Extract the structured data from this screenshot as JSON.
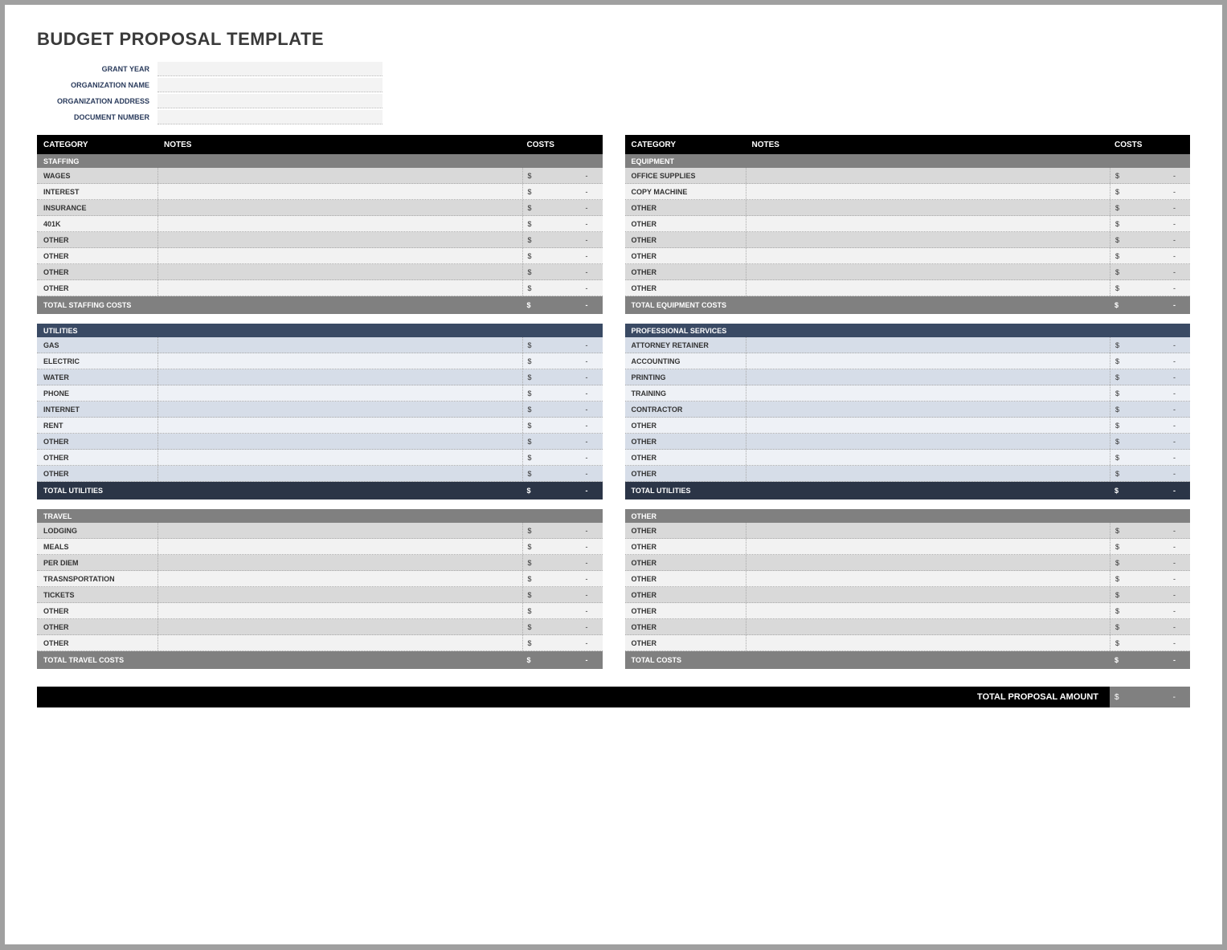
{
  "title": "BUDGET PROPOSAL TEMPLATE",
  "meta": {
    "grant_year_label": "GRANT YEAR",
    "org_name_label": "ORGANIZATION NAME",
    "org_address_label": "ORGANIZATION ADDRESS",
    "doc_number_label": "DOCUMENT NUMBER",
    "grant_year": "",
    "org_name": "",
    "org_address": "",
    "doc_number": ""
  },
  "headers": {
    "category": "CATEGORY",
    "notes": "NOTES",
    "costs": "COSTS"
  },
  "currency": "$",
  "dash": "-",
  "left": {
    "staffing": {
      "title": "STAFFING",
      "rows": [
        "WAGES",
        "INTEREST",
        "INSURANCE",
        "401K",
        "OTHER",
        "OTHER",
        "OTHER",
        "OTHER"
      ],
      "total_label": "TOTAL STAFFING COSTS"
    },
    "utilities": {
      "title": "UTILITIES",
      "rows": [
        "GAS",
        "ELECTRIC",
        "WATER",
        "PHONE",
        "INTERNET",
        "RENT",
        "OTHER",
        "OTHER",
        "OTHER"
      ],
      "total_label": "TOTAL UTILITIES"
    },
    "travel": {
      "title": "TRAVEL",
      "rows": [
        "LODGING",
        "MEALS",
        "PER DIEM",
        "TRASNSPORTATION",
        "TICKETS",
        "OTHER",
        "OTHER",
        "OTHER"
      ],
      "total_label": "TOTAL TRAVEL COSTS"
    }
  },
  "right": {
    "equipment": {
      "title": "EQUIPMENT",
      "rows": [
        "OFFICE SUPPLIES",
        "COPY MACHINE",
        "OTHER",
        "OTHER",
        "OTHER",
        "OTHER",
        "OTHER",
        "OTHER"
      ],
      "total_label": "TOTAL EQUIPMENT COSTS"
    },
    "professional": {
      "title": "PROFESSIONAL SERVICES",
      "rows": [
        "ATTORNEY RETAINER",
        "ACCOUNTING",
        "PRINTING",
        "TRAINING",
        "CONTRACTOR",
        "OTHER",
        "OTHER",
        "OTHER",
        "OTHER"
      ],
      "total_label": "TOTAL UTILITIES"
    },
    "other": {
      "title": "OTHER",
      "rows": [
        "OTHER",
        "OTHER",
        "OTHER",
        "OTHER",
        "OTHER",
        "OTHER",
        "OTHER",
        "OTHER"
      ],
      "total_label": "TOTAL COSTS"
    }
  },
  "grand_total_label": "TOTAL PROPOSAL AMOUNT"
}
